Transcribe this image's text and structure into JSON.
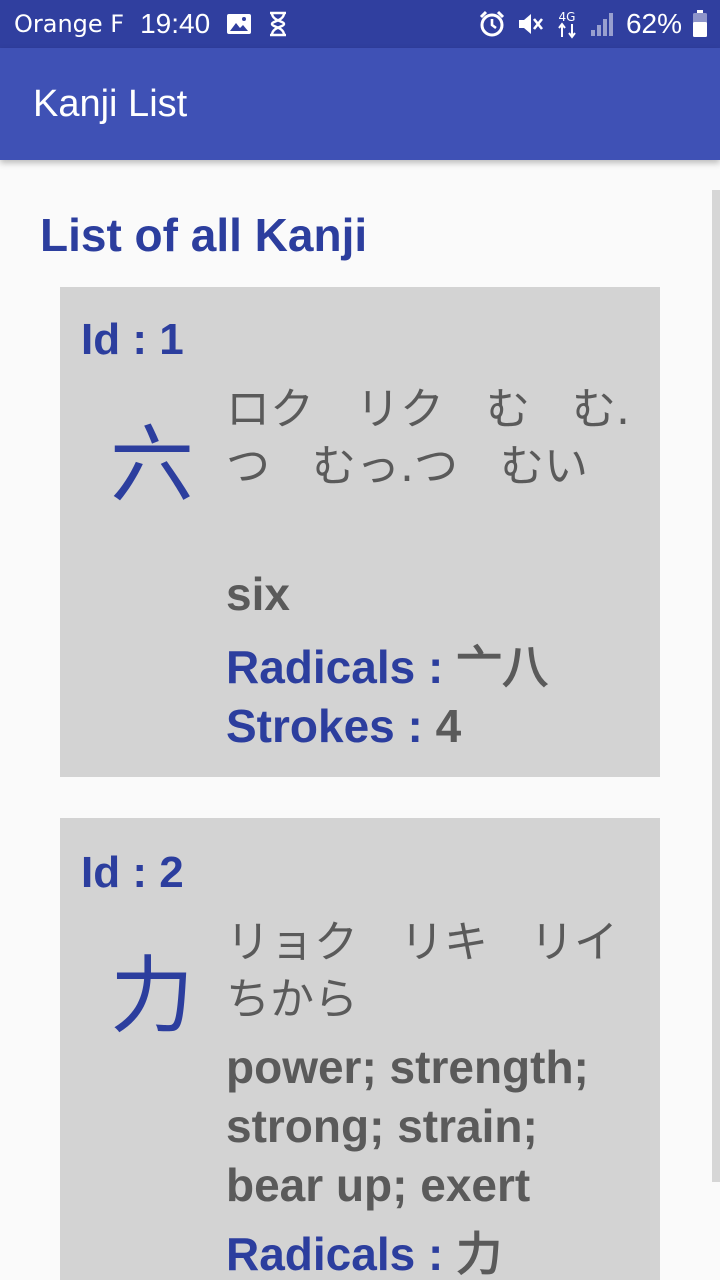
{
  "status_bar": {
    "carrier": "Orange F",
    "time": "19:40",
    "battery": "62%",
    "network": "4G",
    "icons": [
      "image-icon",
      "hourglass-icon",
      "alarm-icon",
      "mute-icon",
      "signal-icon",
      "battery-icon"
    ]
  },
  "app_bar": {
    "title": "Kanji List"
  },
  "colors": {
    "status_bar": "#303f9f",
    "app_bar": "#3f51b5",
    "accent_text": "#2c3e9e",
    "body_text": "#5a5a5a",
    "card_background": "#d3d3d3",
    "page_background": "#fafafa"
  },
  "main": {
    "heading": "List of all Kanji",
    "kanji": [
      {
        "id_label": "Id : 1",
        "character": "六",
        "readings": "ロク リク む む.つ むっ.つ むい",
        "meaning": "six",
        "radicals_label": "Radicals : ",
        "radicals_value": "亠八",
        "strokes_label": "Strokes : ",
        "strokes_value": "4"
      },
      {
        "id_label": "Id : 2",
        "character": "力",
        "readings": "リョク リキ リイ ちから",
        "meaning": "power; strength; strong; strain; bear up; exert",
        "radicals_label": "Radicals : ",
        "radicals_value": "力"
      }
    ]
  }
}
